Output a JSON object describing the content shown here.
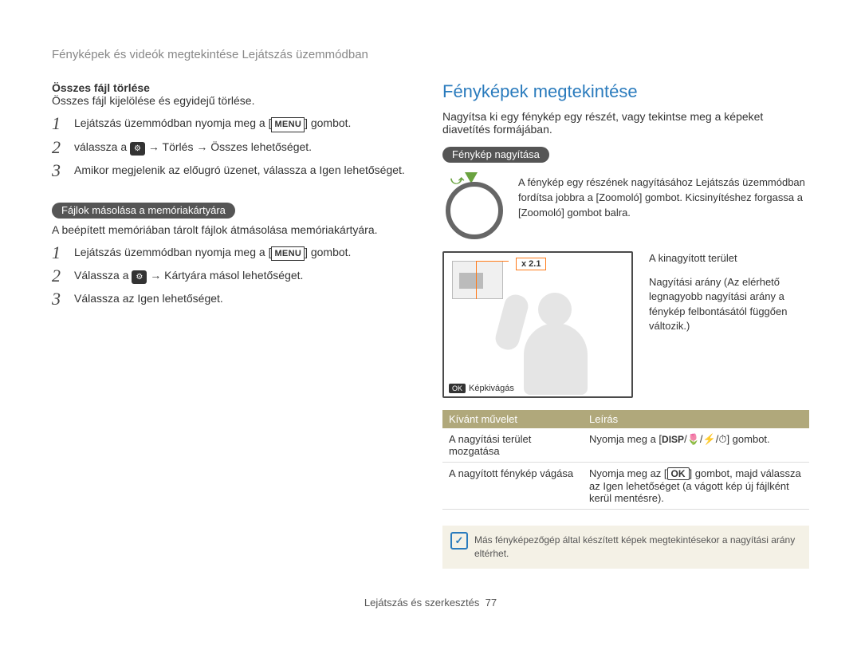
{
  "header": "Fényképek és videók megtekintése Lejátszás üzemmódban",
  "left": {
    "delete_all_title": "Összes fájl törlése",
    "delete_all_desc": "Összes fájl kijelölése és egyidejű törlése.",
    "steps1": {
      "s1a": "Lejátszás üzemmódban nyomja meg a [",
      "s1b": "] gombot.",
      "s2a": "válassza a ",
      "s2b": " → Törlés → Összes lehetőséget.",
      "s3": "Amikor megjelenik az előugró üzenet, válassza a Igen lehetőséget."
    },
    "copy_pill": "Fájlok másolása a memóriakártyára",
    "copy_desc": "A beépített memóriában tárolt fájlok átmásolása memóriakártyára.",
    "steps2": {
      "s1a": "Lejátszás üzemmódban nyomja meg a [",
      "s1b": "] gombot.",
      "s2a": "Válassza a ",
      "s2b": " → Kártyára másol lehetőséget.",
      "s3": "Válassza az Igen lehetőséget."
    }
  },
  "right": {
    "title": "Fényképek megtekintése",
    "intro": "Nagyítsa ki egy fénykép egy részét, vagy tekintse meg a képeket diavetítés formájában.",
    "zoom_pill": "Fénykép nagyítása",
    "dial_text": "A fénykép egy részének nagyításához Lejátszás üzemmódban fordítsa jobbra a [Zoomoló] gombot. Kicsinyítéshez forgassa a [Zoomoló] gombot balra.",
    "screen": {
      "zoom": "x 2.1",
      "crop": "Képkivágás",
      "ok_label": "OK"
    },
    "annot": {
      "a1": "A kinagyított terület",
      "a2": "Nagyítási arány (Az elérhető legnagyobb nagyítási arány a fénykép felbontásától függően változik.)"
    },
    "table": {
      "h1": "Kívánt művelet",
      "h2": "Leírás",
      "r1c1": "A nagyítási terület mozgatása",
      "r1c2a": "Nyomja meg a [",
      "r1c2b": "] gombot.",
      "r2c1": "A nagyított fénykép vágása",
      "r2c2a": "Nyomja meg az [",
      "r2c2b": "] gombot, majd válassza az Igen lehetőséget (a vágott kép új fájlként kerül mentésre)."
    },
    "note": "Más fényképezőgép által készített képek megtekintésekor a nagyítási arány eltérhet."
  },
  "symbols": {
    "menu": "MENU",
    "settings": "⚙",
    "ok": "OK",
    "disp": "DISP",
    "macron": "🌷",
    "flash": "⚡",
    "timer": "⏱",
    "note_icon": "✓"
  },
  "footer": {
    "text": "Lejátszás és szerkesztés",
    "page": "77"
  }
}
